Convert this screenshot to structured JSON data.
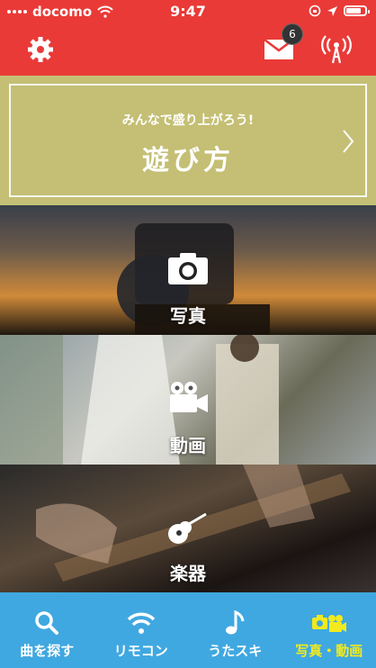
{
  "status": {
    "carrier": "docomo",
    "time": "9:47"
  },
  "header": {
    "unread_count": "6"
  },
  "howto": {
    "subtitle": "みんなで盛り上がろう!",
    "title": "遊び方"
  },
  "panels": {
    "photo": "写真",
    "video": "動画",
    "instrument": "楽器"
  },
  "tabs": [
    {
      "label": "曲を探す",
      "icon": "search-icon"
    },
    {
      "label": "リモコン",
      "icon": "wifi-icon"
    },
    {
      "label": "うたスキ",
      "icon": "music-note-icon"
    },
    {
      "label": "写真・動画",
      "icon": "camera-video-icon",
      "active": true
    }
  ],
  "colors": {
    "header": "#e93a37",
    "howto": "#c4bf74",
    "tabbar": "#40a8e0",
    "active_tab": "#f2ea1e"
  }
}
